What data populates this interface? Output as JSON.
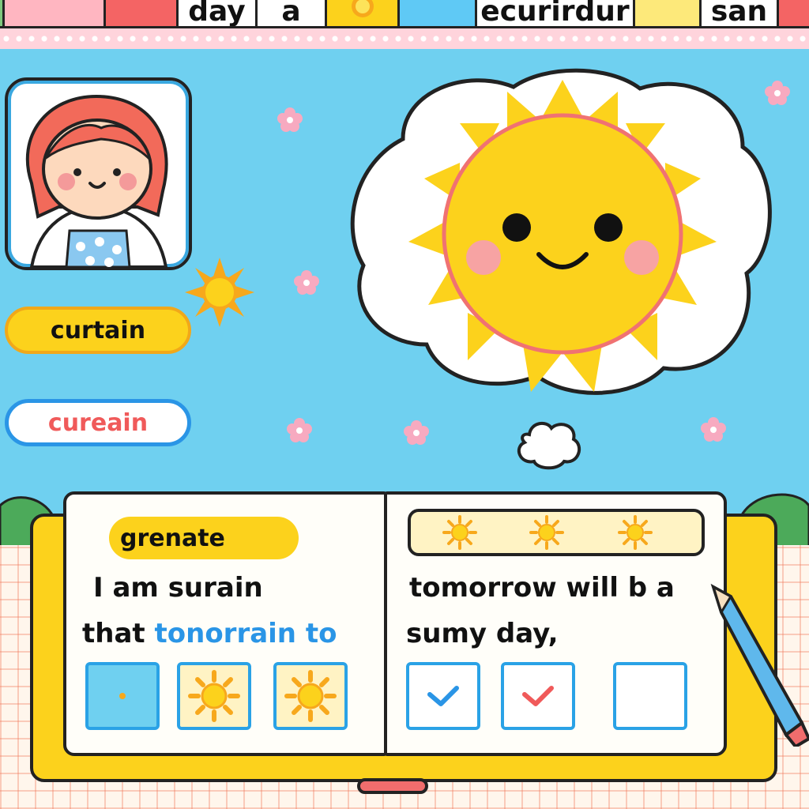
{
  "top_strip": {
    "tiles": [
      {
        "label": "",
        "color": "#ffb6c1"
      },
      {
        "label": "",
        "color": "#f46464"
      },
      {
        "label": "day",
        "color": "#ffffff"
      },
      {
        "label": "a",
        "color": "#ffffff"
      },
      {
        "label": "",
        "color": "#fcd21c",
        "icon": "sun-icon"
      },
      {
        "label": "",
        "color": "#5fc9f5"
      },
      {
        "label": "ecurirdur",
        "color": "#ffffff"
      },
      {
        "label": "",
        "color": "#fde97a"
      },
      {
        "label": "san",
        "color": "#ffffff"
      },
      {
        "label": "",
        "color": "#f46464"
      }
    ]
  },
  "choices": {
    "word_1": "curtain",
    "word_2": "cureain"
  },
  "notebook": {
    "tag": "grenate",
    "left_line_1": "I am surain",
    "left_line_2_prefix": "that",
    "left_line_2_highlight": "tonorrain to",
    "right_line_1": "tomorrow will b a",
    "right_line_2": "sumy day,"
  },
  "colors": {
    "sky": "#6fd0f0",
    "sun": "#fcd21c",
    "accent_blue": "#2a95e6",
    "accent_red": "#f05a5a"
  }
}
